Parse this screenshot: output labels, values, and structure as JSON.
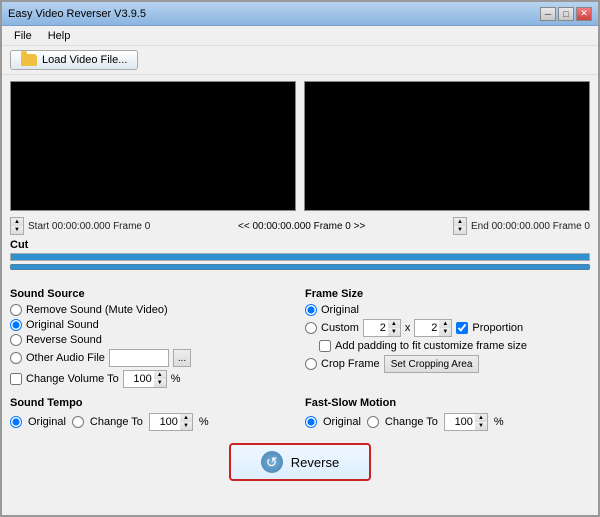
{
  "titlebar": {
    "title": "Easy Video Reverser V3.9.5",
    "min_label": "─",
    "max_label": "□",
    "close_label": "✕"
  },
  "menubar": {
    "items": [
      {
        "id": "file",
        "label": "File"
      },
      {
        "id": "help",
        "label": "Help"
      }
    ]
  },
  "toolbar": {
    "load_label": "Load Video File..."
  },
  "timeline": {
    "start_label": "Start 00:00:00.000 Frame 0",
    "center_label": "<< 00:00:00.000  Frame 0 >>",
    "end_label": "End 00:00:00.000 Frame 0"
  },
  "cut": {
    "section_label": "Cut"
  },
  "sound_source": {
    "title": "Sound Source",
    "options": [
      {
        "id": "remove",
        "label": "Remove Sound (Mute Video)",
        "checked": false
      },
      {
        "id": "original",
        "label": "Original Sound",
        "checked": true
      },
      {
        "id": "reverse",
        "label": "Reverse Sound",
        "checked": false
      },
      {
        "id": "other",
        "label": "Other Audio File",
        "checked": false
      }
    ],
    "change_volume_label": "Change Volume To",
    "volume_value": "100",
    "percent_label": "%"
  },
  "frame_size": {
    "title": "Frame Size",
    "options": [
      {
        "id": "original",
        "label": "Original",
        "checked": true
      },
      {
        "id": "custom",
        "label": "Custom",
        "checked": false
      },
      {
        "id": "crop",
        "label": "Crop Frame",
        "checked": false
      }
    ],
    "custom_w": "2",
    "custom_x_label": "x",
    "custom_h": "2",
    "proportion_label": "Proportion",
    "add_padding_label": "Add padding to fit customize frame size",
    "set_crop_label": "Set Cropping Area"
  },
  "sound_tempo": {
    "title": "Sound Tempo",
    "original_label": "Original",
    "change_to_label": "Change To",
    "tempo_value": "100",
    "percent_label": "%"
  },
  "fast_slow": {
    "title": "Fast-Slow Motion",
    "original_label": "Original",
    "change_to_label": "Change To",
    "value": "100",
    "percent_label": "%"
  },
  "reverse_btn": {
    "label": "Reverse"
  }
}
